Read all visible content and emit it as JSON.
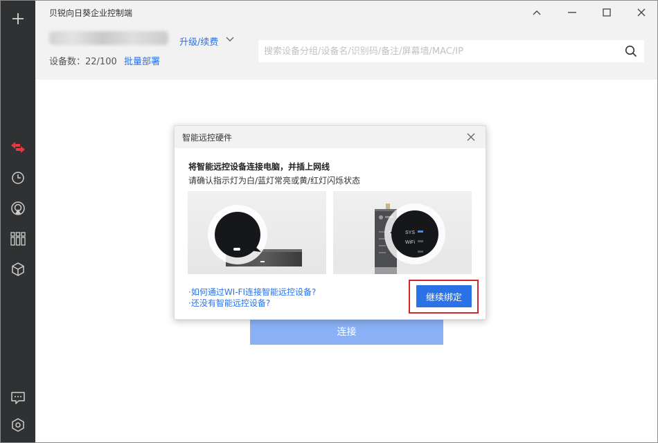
{
  "window": {
    "title": "贝锐向日葵企业控制端"
  },
  "header": {
    "upgrade_label": "升级/续费",
    "device_count_label": "设备数：22/100",
    "batch_deploy_label": "批量部署",
    "search_placeholder": "搜索设备分组/设备名/识别码/备注/屏幕墙/MAC/IP"
  },
  "sidebar": {
    "top_icon": "plus-icon",
    "items": [
      {
        "icon": "remote-control-icon",
        "active": true
      },
      {
        "icon": "history-clock-icon",
        "active": false
      },
      {
        "icon": "broadcast-icon",
        "active": false
      },
      {
        "icon": "apps-grid-icon",
        "active": false
      },
      {
        "icon": "cube-icon",
        "active": false
      }
    ],
    "bottom_items": [
      {
        "icon": "message-icon"
      },
      {
        "icon": "settings-icon"
      }
    ]
  },
  "main": {
    "connect_label": "连接"
  },
  "modal": {
    "title": "智能远控硬件",
    "heading": "将智能远控设备连接电脑，并插上网线",
    "subtext": "请确认指示灯为白/蓝灯常亮或黄/红灯闪烁状态",
    "help_links": [
      "·如何通过WI-FI连接智能远控设备?",
      "·还没有智能远控设备?"
    ],
    "continue_label": "继续绑定",
    "device_labels": {
      "sys": "SYS",
      "wifi": "WiFi"
    }
  },
  "colors": {
    "accent": "#2b72e6",
    "sidebar_bg": "#2f3133",
    "active_icon": "#e8383d",
    "highlight": "#d0262a",
    "connect_disabled": "#8ab1f5"
  }
}
